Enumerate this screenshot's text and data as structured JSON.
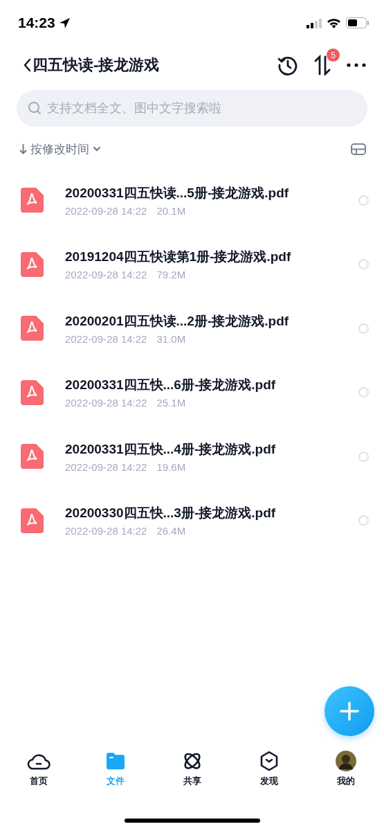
{
  "status_bar": {
    "time": "14:23"
  },
  "header": {
    "title": "四五快读-接龙游戏",
    "badge": "5"
  },
  "search": {
    "placeholder": "支持文档全文、图中文字搜索啦"
  },
  "sort": {
    "label": "按修改时间"
  },
  "files": [
    {
      "name": "20200331四五快读...5册-接龙游戏.pdf",
      "date": "2022-09-28 14:22",
      "size": "20.1M",
      "selected": false
    },
    {
      "name": "20191204四五快读第1册-接龙游戏.pdf",
      "date": "2022-09-28 14:22",
      "size": "79.2M",
      "selected": false
    },
    {
      "name": "20200201四五快读...2册-接龙游戏.pdf",
      "date": "2022-09-28 14:22",
      "size": "31.0M",
      "selected": false
    },
    {
      "name": "20200331四五快...6册-接龙游戏.pdf",
      "date": "2022-09-28 14:22",
      "size": "25.1M",
      "selected": false
    },
    {
      "name": "20200331四五快...4册-接龙游戏.pdf",
      "date": "2022-09-28 14:22",
      "size": "19.6M",
      "selected": false
    },
    {
      "name": "20200330四五快...3册-接龙游戏.pdf",
      "date": "2022-09-28 14:22",
      "size": "26.4M",
      "selected": false
    }
  ],
  "tab_bar": [
    {
      "kind": "home",
      "label": "首页",
      "selected": false
    },
    {
      "kind": "files",
      "label": "文件",
      "selected": true
    },
    {
      "kind": "share",
      "label": "共享",
      "selected": false
    },
    {
      "kind": "discover",
      "label": "发现",
      "selected": false
    },
    {
      "kind": "me",
      "label": "我的",
      "selected": false
    }
  ]
}
